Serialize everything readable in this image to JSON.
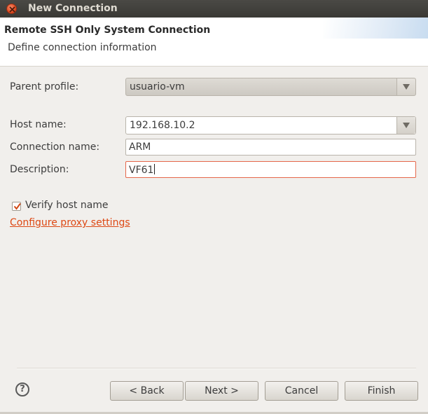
{
  "window": {
    "title": "New Connection"
  },
  "header": {
    "title": "Remote SSH Only System Connection",
    "subtitle": "Define connection information"
  },
  "form": {
    "parent_profile": {
      "label": "Parent profile:",
      "value": "usuario-vm"
    },
    "host_name": {
      "label": "Host name:",
      "value": "192.168.10.2"
    },
    "connection_name": {
      "label": "Connection name:",
      "value": "ARM"
    },
    "description": {
      "label": "Description:",
      "value": "VF61"
    },
    "verify_host": {
      "label": "Verify host name",
      "checked": true
    },
    "proxy_link": "Configure proxy settings"
  },
  "buttons": {
    "back": "< Back",
    "next": "Next >",
    "cancel": "Cancel",
    "finish": "Finish"
  },
  "help": {
    "icon": "help-icon",
    "glyph": "?"
  },
  "colors": {
    "accent": "#dd4814",
    "titlebar": "#3c3b37",
    "focus_border": "#e5674a"
  }
}
